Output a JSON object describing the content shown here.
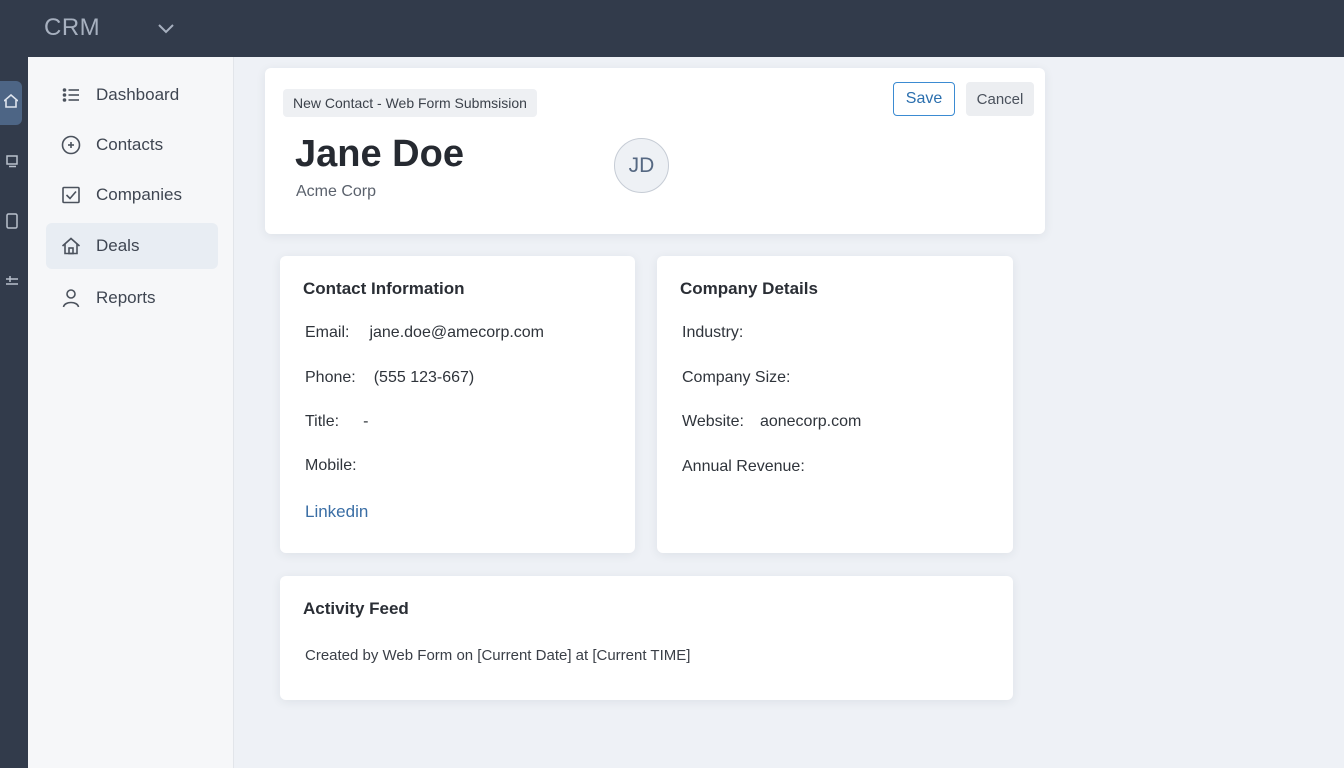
{
  "app": {
    "title": "CRM"
  },
  "sidebar": {
    "items": [
      {
        "label": "Dashboard",
        "icon": "list-icon"
      },
      {
        "label": "Contacts",
        "icon": "plus-circle-icon"
      },
      {
        "label": "Companies",
        "icon": "checkbox-icon"
      },
      {
        "label": "Deals",
        "icon": "home-icon",
        "active": true
      },
      {
        "label": "Reports",
        "icon": "user-icon"
      }
    ]
  },
  "header": {
    "tag": "New Contact - Web Form Submsision",
    "name": "Jane Doe",
    "company": "Acme Corp",
    "initials": "JD",
    "save_label": "Save",
    "cancel_label": "Cancel"
  },
  "contact_info": {
    "title": "Contact Information",
    "email_label": "Email:",
    "email": "jane.doe@amecorp.com",
    "phone_label": "Phone:",
    "phone": "(555 123-667)",
    "title_label": "Title:",
    "title_value": "-",
    "mobile_label": "Mobile:",
    "mobile": "",
    "linkedin_label": "Linkedin"
  },
  "company_details": {
    "title": "Company Details",
    "industry_label": "Industry:",
    "industry": "",
    "size_label": "Company Size:",
    "size": "",
    "website_label": "Website:",
    "website": "aonecorp.com",
    "revenue_label": "Annual Revenue:",
    "revenue": ""
  },
  "activity": {
    "title": "Activity Feed",
    "entry": "Created by Web Form on [Current Date] at [Current TIME]"
  },
  "colors": {
    "topbar": "#323b4b",
    "accent": "#3b8bd2",
    "link": "#3a6ea5"
  }
}
